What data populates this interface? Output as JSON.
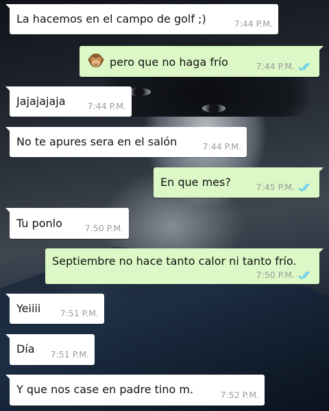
{
  "messages": [
    {
      "direction": "in",
      "text": "La hacemos en el campo de golf ;)",
      "time": "7:44 P.M."
    },
    {
      "direction": "out",
      "emoji": "see-no-evil-monkey",
      "text": "pero que no haga frío",
      "time": "7:44 P.M.",
      "status": "read"
    },
    {
      "direction": "in",
      "text": "Jajajajaja",
      "time": "7:44 P.M."
    },
    {
      "direction": "in",
      "text": "No te apures sera en el salón",
      "time": "7:44 P.M."
    },
    {
      "direction": "out",
      "text": "En que mes?",
      "time": "7:45 P.M.",
      "status": "read"
    },
    {
      "direction": "in",
      "text": "Tu ponlo",
      "time": "7:50 P.M."
    },
    {
      "direction": "out",
      "text": "Septiembre no hace tanto calor ni tanto frío.",
      "time": "7:50 P.M.",
      "status": "read"
    },
    {
      "direction": "in",
      "text": "Yeiiii",
      "time": "7:51 P.M."
    },
    {
      "direction": "in",
      "text": "Día",
      "time": "7:51 P.M."
    },
    {
      "direction": "in",
      "text": "Y que nos case en padre tino m.",
      "time": "7:52 P.M."
    }
  ],
  "colors": {
    "incoming_bubble": "#ffffff",
    "outgoing_bubble": "#dcf8c6",
    "timestamp": "#9a9a9a",
    "read_ticks": "#4fc3f7"
  }
}
